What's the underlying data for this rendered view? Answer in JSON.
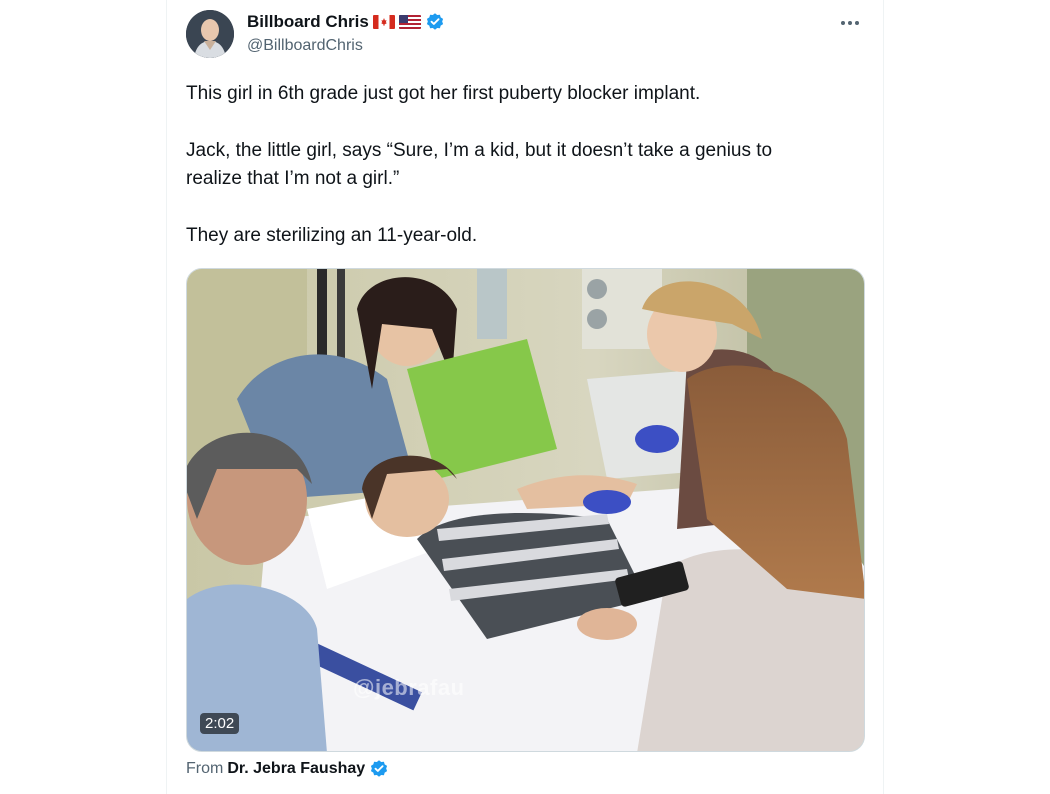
{
  "author": {
    "display_name": "Billboard Chris",
    "handle": "@BillboardChris",
    "verified": true
  },
  "more_label": "···",
  "tweet": {
    "paragraphs": [
      "This girl in 6th grade just got her first puberty blocker implant.",
      "Jack, the little girl, says “Sure, I’m a kid, but it doesn’t take a genius to\nrealize that I’m not a girl.”",
      "They are sterilizing an 11-year-old."
    ]
  },
  "media": {
    "type": "video",
    "duration": "2:02",
    "watermark": "@jebrafau"
  },
  "source": {
    "prefix": "From",
    "name": "Dr. Jebra Faushay",
    "verified": true
  },
  "colors": {
    "verified_blue": "#1d9bf0",
    "text_primary": "#0f1419",
    "text_secondary": "#536471",
    "border": "#cfd9de"
  }
}
